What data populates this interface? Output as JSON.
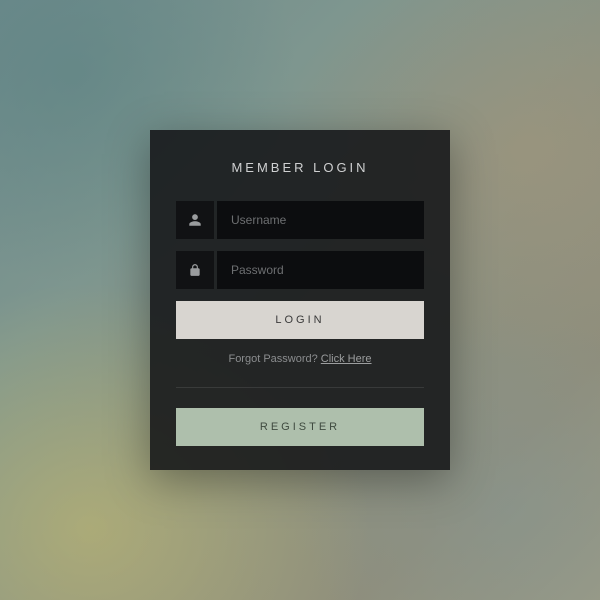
{
  "title": "MEMBER LOGIN",
  "username": {
    "placeholder": "Username",
    "value": ""
  },
  "password": {
    "placeholder": "Password",
    "value": ""
  },
  "login_label": "LOGIN",
  "forgot": {
    "text": "Forgot Password? ",
    "link": "Click Here"
  },
  "register_label": "REGISTER",
  "colors": {
    "card_bg": "rgba(20,22,24,0.88)",
    "login_btn": "#d8d5d0",
    "register_btn": "#aebfac"
  }
}
